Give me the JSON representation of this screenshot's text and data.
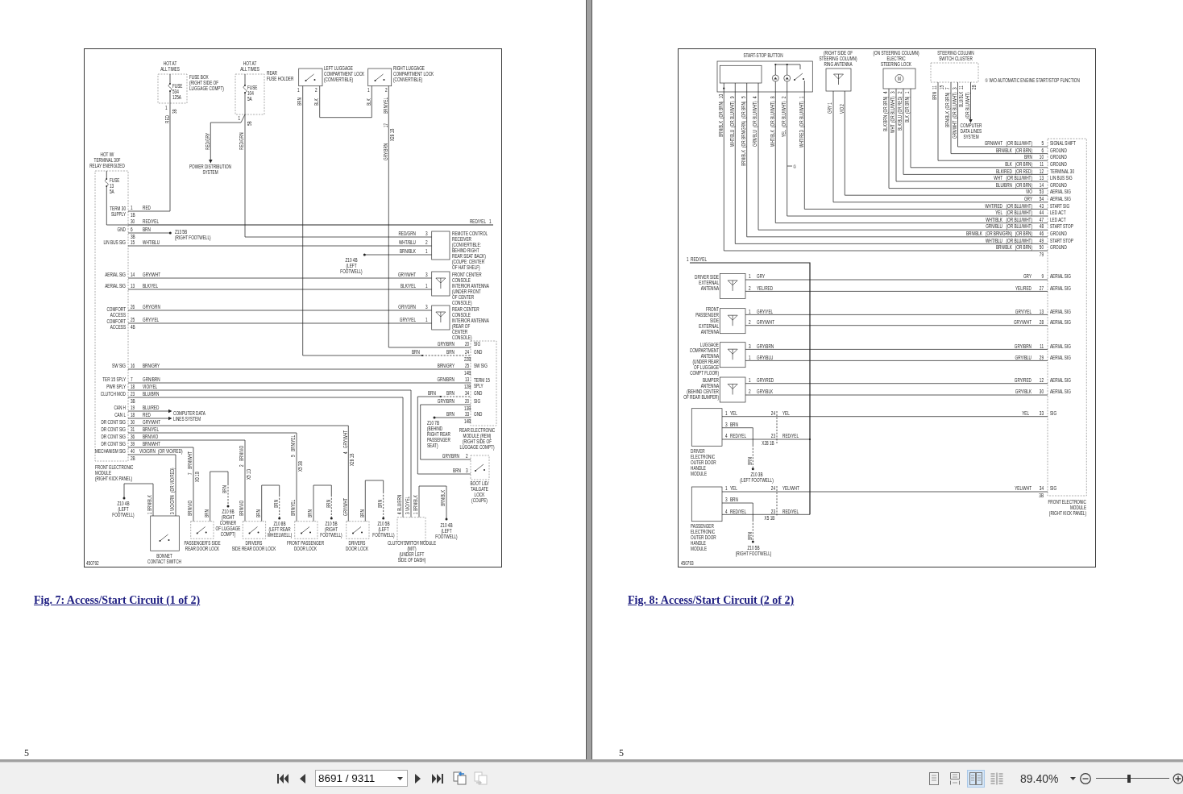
{
  "pages": [
    {
      "diagram": {
        "labels": [
          "HOT AT\nALL TIMES",
          "FUSE\n534\n125A",
          "FUSE BOX\n(RIGHT SIDE OF\nLUGGAGE COMPT)",
          "HOT AT\nALL TIMES",
          "REAR\nFUSE HOLDER",
          "FUSE\n104\n5A",
          "LEFT LUGGAGE\nCOMPARTMENT LOCK\n(CONVERTIBLE)",
          "RIGHT LUGGAGE\nCOMPARTMENT LOCK\n(CONVERTIBLE)",
          "1",
          "2",
          "1",
          "2",
          "1",
          "3B",
          "BRN",
          "BLK",
          "BLK",
          "BRN/YEL",
          "RED",
          "1",
          "5B",
          "17",
          "RED/GRY",
          "RED/GRN",
          "X28 1B",
          "HOT W/\nTERMINAL 30F\nRELAY ENERGIZED",
          "GRY/BRN",
          "POWER DISTRIBUTION\nSYSTEM",
          "FUSE\n13\n5A",
          "TERM 30\nSUPPLY",
          "1",
          "RED",
          "1B",
          "30",
          "RED/YEL",
          "RED/YEL",
          "1",
          "GND",
          "6",
          "BRN",
          "3B",
          "Z13 5B\n(RIGHT FOOTWELL)",
          "RED/GRN",
          "3",
          "LIN BUS SIG",
          "15",
          "WHT/BLU",
          "WHT/BLU",
          "2",
          "BRN/BLK",
          "1",
          "Z10 4B\n(LEFT\nFOOTWELL)",
          "REMOTE CONTROL\nRECEIVER\n(CONVERTIBLE:\nBEHIND RIGHT\nREAR SEAT BACK)\n(COUPE: CENTER\nOF HAT SHELF)",
          "AERIAL SIG",
          "14",
          "GRY/WHT",
          "GRY/WHT",
          "3",
          "AERIAL SIG",
          "13",
          "BLK/YEL",
          "BLK/YEL",
          "1",
          "FRONT CENTER\nCONSOLE\nINTERIOR ANTENNA\n(UNDER FRONT\nOF CENTER\nCONSOLE)",
          "COMFORT\nACCESS",
          "26",
          "GRY/GRN",
          "GRY/GRN",
          "3",
          "COMFORT\nACCESS",
          "25",
          "GRY/YEL",
          "GRY/YEL",
          "1",
          "4B",
          "REAR CENTER\nCONSOLE\nINTERIOR ANTENNA\n(REAR OF\nCENTER\nCONSOLE)",
          "GRY/BRN",
          "20",
          "SIG",
          "BRN",
          "BRN",
          "24",
          "GND",
          "22B",
          "SW SIG",
          "16",
          "BRN/GRY",
          "BRN/GRY",
          "25",
          "SW SIG",
          "14B",
          "TER 15 SPLY",
          "7",
          "GRN/BRN",
          "PWR SPLY",
          "18",
          "VIO/YEL",
          "GRN/BRN",
          "13",
          "12B",
          "TERM 15\nSPLY",
          "CLUTCH MOD",
          "23",
          "BLU/BRN",
          "3B",
          "BRN",
          "BRN",
          "34",
          "GND",
          "GRY/BRN",
          "20",
          "SIG",
          "CAN H",
          "19",
          "BLU/RED",
          "13B",
          "CAN L",
          "18",
          "RED",
          "COMPUTER DATA\nLINES SYSTEM",
          "BRN",
          "33",
          "GND",
          "DR CONT SIG",
          "30",
          "GRY/WHT",
          "DR CONT SIG",
          "31",
          "BRN/YEL",
          "DR CONT SIG",
          "36",
          "BRN/VIO",
          "DR CONT SIG",
          "39",
          "BRN/WHT",
          "MECHANISM SIG",
          "40",
          "VIO/GRN",
          "(OR VIO/RED)",
          "2B",
          "Z10 7B\n(BEHIND\nRIGHT REAR\nPASSENGER\nSEAT)",
          "REAR ELECTRONIC\nMODULE (REM)\n(RIGHT SIDE OF\nLUGGAGE COMPT)",
          "14B",
          "GRY/BRN",
          "2",
          "FRONT ELECTRONIC\nMODULE\n(RIGHT KICK PANEL)",
          "BRN",
          "3",
          "450792",
          "Z10 4B\n(LEFT\nFOOTWELL)",
          "BONNET\nCONTACT SWITCH",
          "1 BRN/BLK",
          "(OR VIO/RED)",
          "3 VIO/GRN",
          "PASSENGER'S SIDE\nREAR DOOR LOCK",
          "BRN/WHT",
          "7",
          "BRN/VIO",
          "X0 1B",
          "BRN",
          "Z10 9B\n(RIGHT\nCORNER\nOF LUGGAGE\nCOMPT)",
          "BRN",
          "DRIVERS\nSIDE REAR DOOR LOCK",
          "BRN/VIO",
          "2",
          "BRN/VIO",
          "X5 1D",
          "BRN",
          "Z10 8B\n(LEFT REAR\nWHEELWELL)",
          "BRN",
          "FRONT PASSENGER\nDOOR LOCK",
          "BRN/YEL",
          "5",
          "BRN/YEL",
          "X5 3B",
          "BRN",
          "Z10 5B\n(RIGHT\nFOOTWELL)",
          "BRN",
          "GRY/WHT",
          "4",
          "GRY/WHT",
          "DRIVERS\nDOOR LOCK",
          "X28 1B",
          "BRN",
          "Z10 5B\n(LEFT\nFOOTWELL)",
          "BRN",
          "CLUTCH SWITCH MODULE\n(M/T)\n(UNDER LEFT\nSIDE OF DASH)",
          "4 BLU/BRN",
          "3 VIO/YEL",
          "1 BRN/BLK",
          "Z10 4B\n(LEFT\nFOOTWELL)",
          "BRN/BLK",
          "BOOT LID/\nTAILGATE\nLOCK\n(COUPE)"
        ]
      },
      "caption": "Fig. 7: Access/Start Circuit (1 of 2)",
      "page_number": "5"
    },
    {
      "diagram": {
        "labels": [
          "START-STOP BUTTON",
          "(RIGHT SIDE OF\nSTEERING COLUMN)\nRING ANTENNA",
          "(ON STEERING COLUMN)\nELECTRIC\nSTEERING LOCK",
          "STEERING COLUMN\nSWITCH CLUSTER",
          "M",
          "① W/O AUTOMATIC ENGINE START/STOP FUNCTION",
          "11",
          "15",
          "7",
          "3",
          "11",
          "2B",
          "4",
          "3",
          "2",
          "1",
          "10",
          "9",
          "5",
          "4",
          "8",
          "2",
          "1",
          "(OR BRN)",
          "BRN/BLK",
          "(OR BLU/WHT)",
          "WHT/BLU",
          "(OR BRN)",
          "(OR BRN/GRN)",
          "BRN/BLK",
          "(OR BLU/WHT)",
          "GRN/BLU",
          "(OR BLU/WHT)",
          "WHT/BLK",
          "(OR BLU/WHT)",
          "YEL",
          "(OR BLU/WHT)",
          "WHT/RED",
          "①",
          "GRY 1",
          "VIO 2",
          "(OR BRN)",
          "BLK/BRN",
          "(OR BLU/WHT)",
          "WHT",
          "(OR RED)",
          "BLK/BLU",
          "(OR BRN)",
          "BLK",
          "BRN",
          "(OR BRN)",
          "BRN/BLK",
          "(OR BLU/WHT)",
          "GRN/WHT",
          "BLU/BLK",
          "(OR BLU/WHT)",
          "COMPUTER\nDATA LINES\nSYSTEM",
          "1",
          "RED/YEL",
          "79",
          "DRIVER SIDE\nEXTERNAL\nANTENNA",
          "1",
          "GRY",
          "GRY",
          "9",
          "AERIAL SIG",
          "2",
          "YEL/RED",
          "YEL/RED",
          "27",
          "AERIAL SIG",
          "FRONT\nPASSENGER\nSIDE\nEXTERNAL\nANTENNA",
          "1",
          "GRY/YEL",
          "GRY/YEL",
          "13",
          "AERIAL SIG",
          "2",
          "GRY/WHT",
          "GRY/WHT",
          "28",
          "AERIAL SIG",
          "LUGGAGE\nCOMPARTMENT\nANTENNA\n(UNDER REAR\nOF LUGGAGE\nCOMPT FLOOR)",
          "3",
          "GRY/BRN",
          "GRY/BRN",
          "11",
          "AERIAL SIG",
          "1",
          "GRY/BLU",
          "GRY/BLU",
          "29",
          "AERIAL SIG",
          "BUMPER\nANTENNA\n(BEHIND CENTER\nOF REAR BUMPER)",
          "1",
          "GRY/RED",
          "GRY/RED",
          "12",
          "AERIAL SIG",
          "2",
          "GRY/BLK",
          "GRY/BLK",
          "30",
          "AERIAL SIG",
          "1",
          "YEL",
          "24",
          "YEL",
          "YEL",
          "33",
          "SIG",
          "3",
          "BRN",
          "4",
          "RED/YEL",
          "23",
          "RED/YEL",
          "X28 1B",
          "DRIVER\nELECTRONIC\nOUTER DOOR\nHANDLE\nMODULE",
          "BRN",
          "Z10 3B\n(LEFT FOOTWELL)",
          "1",
          "YEL",
          "24",
          "YEL/WHT",
          "YEL/WHT",
          "34",
          "SIG",
          "3",
          "BRN",
          "3B",
          "4",
          "RED/YEL",
          "23",
          "RED/YEL",
          "X5 1B",
          "FRONT ELECTRONIC\nMODULE\n(RIGHT KICK PANEL)",
          "PASSENGER\nELECTRONIC\nOUTER DOOR\nHANDLE\nMODULE",
          "BRN",
          "Z10 5B\n(RIGHT FOOTWELL)",
          "450793"
        ],
        "module_rows": [
          {
            "wire": "GRN/WHT",
            "alt": [
              "(OR BLU/WHT)"
            ],
            "pin": "5",
            "signal": "SIGNAL SHIFT"
          },
          {
            "wire": "BRN/BLK",
            "alt": [
              "(OR BRN)"
            ],
            "pin": "6",
            "signal": "GROUND"
          },
          {
            "wire": "BRN",
            "pin": "10",
            "signal": "GROUND"
          },
          {
            "wire": "BLK",
            "alt": [
              "(OR BRN)"
            ],
            "pin": "11",
            "signal": "GROUND"
          },
          {
            "wire": "BLK/RED",
            "alt": [
              "(OR RED)"
            ],
            "pin": "12",
            "signal": "TERMINAL 30"
          },
          {
            "wire": "WHT",
            "alt": [
              "(OR BLU/WHT)"
            ],
            "pin": "13",
            "signal": "LIN BUS SIG"
          },
          {
            "wire": "BLU/BRN",
            "alt": [
              "(OR BRN)"
            ],
            "pin": "14",
            "signal": "GROUND"
          },
          {
            "wire": "VIO",
            "pin": "53",
            "signal": "AERIAL SIG"
          },
          {
            "wire": "GRY",
            "pin": "54",
            "signal": "AERIAL SIG"
          },
          {
            "wire": "WHT/RED",
            "alt": [
              "(OR BLU/WHT)"
            ],
            "pin": "43",
            "signal": "START SIG"
          },
          {
            "wire": "YEL",
            "alt": [
              "(OR BLU/WHT)"
            ],
            "pin": "44",
            "signal": "LED ACT"
          },
          {
            "wire": "WHT/BLK",
            "alt": [
              "(OR BLU/WHT)"
            ],
            "pin": "47",
            "signal": "LED ACT"
          },
          {
            "wire": "GRN/BLU",
            "alt": [
              "(OR BLU/WHT)"
            ],
            "pin": "48",
            "signal": "START STOP"
          },
          {
            "wire": "BRN/BLK",
            "alt": [
              "(OR BRN/GRN)",
              "(OR BRN)"
            ],
            "pin": "46",
            "signal": "GROUND"
          },
          {
            "wire": "WHT/BLU",
            "alt": [
              "(OR BLU/WHT)"
            ],
            "pin": "49",
            "signal": "START STOP"
          },
          {
            "wire": "BRN/BLK",
            "alt": [
              "(OR BRN)"
            ],
            "pin": "50",
            "signal": "GROUND"
          }
        ]
      },
      "caption": "Fig. 8: Access/Start Circuit (2 of 2)",
      "page_number": "5"
    }
  ],
  "toolbar": {
    "page_field": {
      "value": "8691 / 9311"
    },
    "tools": [
      {
        "kind": "extract",
        "disabled": false
      },
      {
        "kind": "insert",
        "disabled": true
      }
    ],
    "view_modes": [
      {
        "kind": "single",
        "selected": false
      },
      {
        "kind": "continuous",
        "selected": false
      },
      {
        "kind": "facing",
        "selected": true
      },
      {
        "kind": "continuous_facing",
        "selected": false
      }
    ],
    "zoom": {
      "value": "89.40%",
      "level": 0.45
    }
  }
}
